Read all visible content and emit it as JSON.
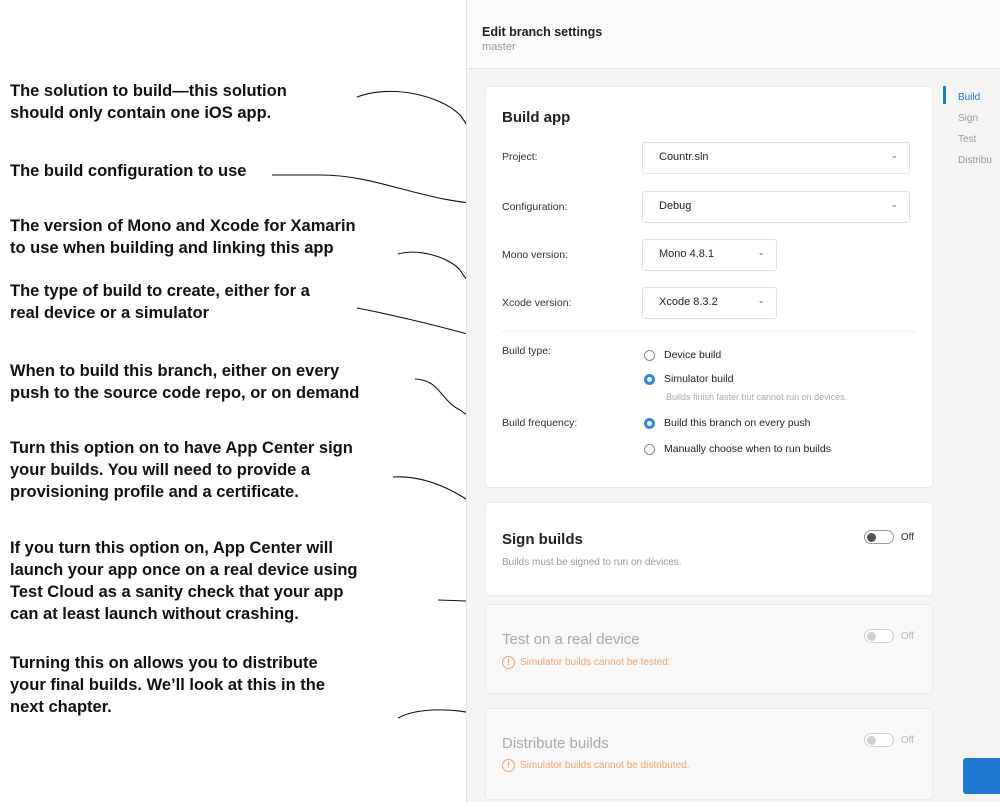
{
  "annotations": {
    "solution": "The solution to build—this solution\nshould only contain one iOS app.",
    "configuration": "The build configuration to use",
    "mono": "The version of Mono and Xcode for Xamarin\nto use when building and linking this app",
    "build_type": "The type of build to create, either for a\nreal device or a simulator",
    "frequency": "When to build this branch, either on every\npush to the source code repo, or on demand",
    "sign": "Turn this option on to have App Center sign\nyour builds. You will need to provide a\nprovisioning profile and a certificate.",
    "test": "If you turn this option on, App Center will\nlaunch your app once on a real device using\nTest Cloud as a sanity check that your app\ncan at least launch without crashing.",
    "distribute": "Turning this on allows you to distribute\nyour final builds. We’ll look at this in the\nnext chapter."
  },
  "header": {
    "title": "Edit branch settings",
    "subtitle": "master"
  },
  "nav": {
    "items": [
      "Build",
      "Sign",
      "Test",
      "Distribu"
    ]
  },
  "build_app": {
    "title": "Build app",
    "project_label": "Project:",
    "project_value": "Countr.sln",
    "configuration_label": "Configuration:",
    "configuration_value": "Debug",
    "mono_label": "Mono version:",
    "mono_value": "Mono 4.8.1",
    "xcode_label": "Xcode version:",
    "xcode_value": "Xcode 8.3.2",
    "build_type_label": "Build type:",
    "device_build": "Device build",
    "simulator_build": "Simulator build",
    "simulator_hint": "Builds finish faster but cannot run on devices.",
    "frequency_label": "Build frequency:",
    "every_push": "Build this branch on every push",
    "manual": "Manually choose when to run builds"
  },
  "sign": {
    "title": "Sign builds",
    "description": "Builds must be signed to run on devices.",
    "toggle": "Off"
  },
  "test": {
    "title": "Test on a real device",
    "warning": "Simulator builds cannot be tested.",
    "toggle": "Off"
  },
  "distribute": {
    "title": "Distribute builds",
    "warning": "Simulator builds cannot be distributed.",
    "toggle": "Off"
  },
  "icons": {
    "chevron": "chevron-down-icon",
    "warning": "warning-icon"
  },
  "colors": {
    "accent": "#1f78d1",
    "warning": "#f2a56a"
  }
}
